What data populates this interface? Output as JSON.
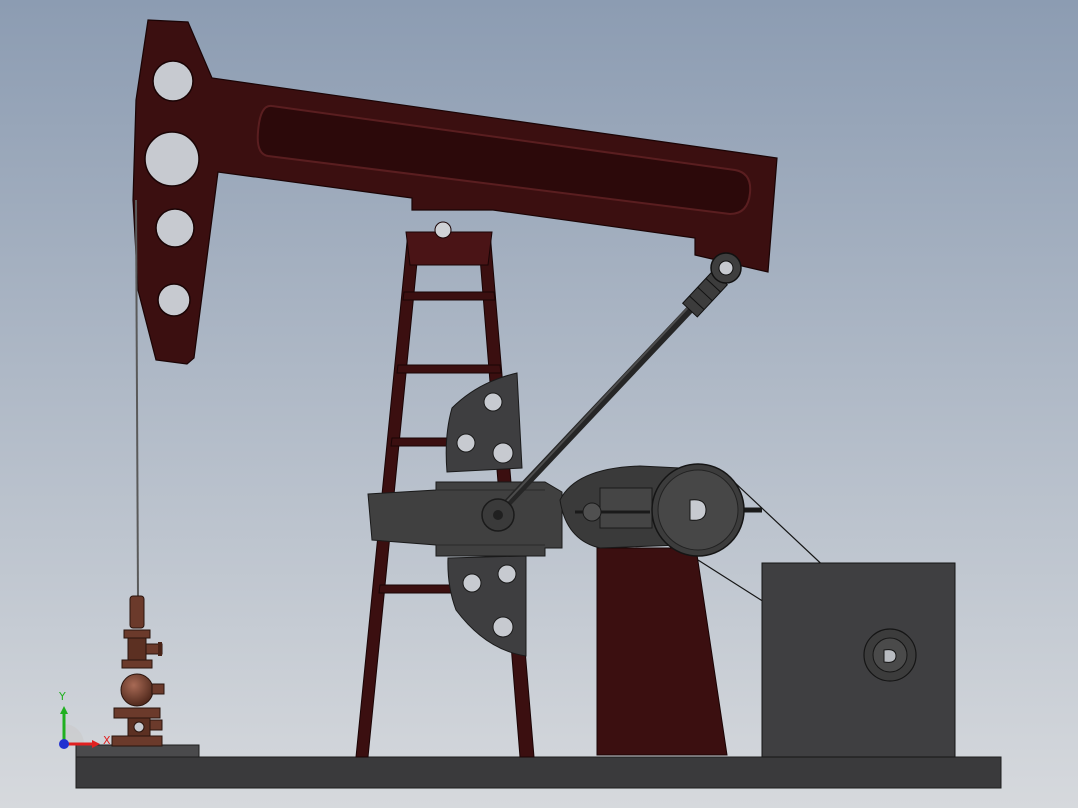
{
  "viewport": {
    "background_top": "#8c9cb2",
    "background_bottom": "#d6d9dd"
  },
  "colors": {
    "beam": "#3b0f10",
    "beam_dark": "#240708",
    "beam_slot": "#2c090a",
    "steel": "#404040",
    "steel_dark": "#262626",
    "steel_light": "#5a5a5a",
    "bronze": "#6b3a2b",
    "bronze_light": "#8a5240",
    "base": "#3a3a3c",
    "cable": "#5a5a5a"
  },
  "triad": {
    "x_label": "X",
    "y_label": "Y",
    "x_color": "#e02020",
    "y_color": "#20b020",
    "z_color": "#2030d0"
  }
}
